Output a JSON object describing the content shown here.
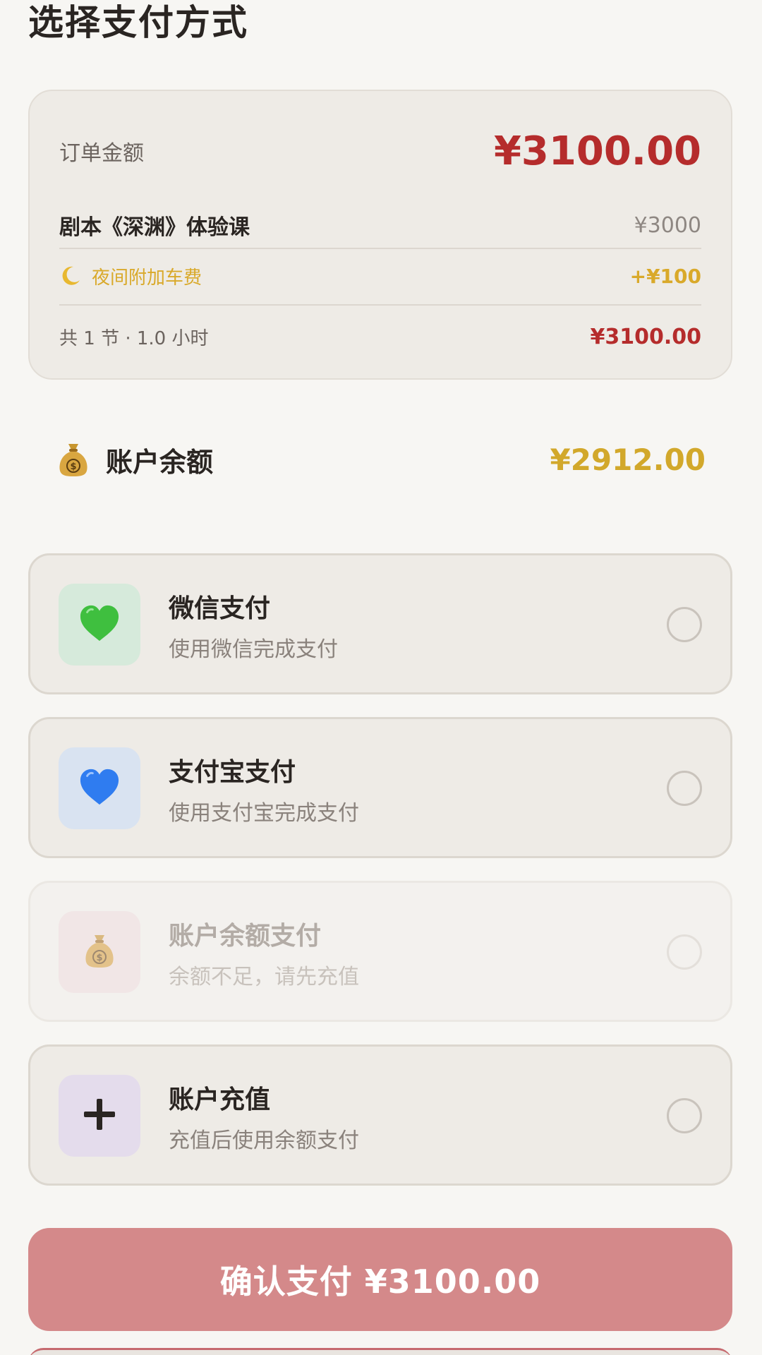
{
  "page": {
    "title": "选择支付方式"
  },
  "order": {
    "amount_label": "订单金额",
    "amount_value": "¥3100.00",
    "course_label": "剧本《深渊》体验课",
    "course_value": "¥3000",
    "surcharge_icon": "moon-icon",
    "surcharge_label": "夜间附加车费",
    "surcharge_value": "+¥100",
    "total_label": "共 1 节 · 1.0 小时",
    "total_value": "¥3100.00"
  },
  "balance": {
    "icon": "money-bag-icon",
    "label": "账户余额",
    "value": "¥2912.00"
  },
  "payment_options": [
    {
      "icon": "green-heart-icon",
      "title": "微信支付",
      "subtitle": "使用微信完成支付",
      "selected": false,
      "enabled": true,
      "icon_bg": "#d6eadb",
      "icon_color": "#3fbf3f"
    },
    {
      "icon": "blue-heart-icon",
      "title": "支付宝支付",
      "subtitle": "使用支付宝完成支付",
      "selected": false,
      "enabled": true,
      "icon_bg": "#d9e3f1",
      "icon_color": "#2f7cf0"
    },
    {
      "icon": "money-bag-icon",
      "title": "账户余额支付",
      "subtitle": "余额不足，请先充值",
      "selected": false,
      "enabled": false,
      "icon_bg": "#f1e6e6"
    },
    {
      "icon": "plus-icon",
      "title": "账户充值",
      "subtitle": "充值后使用余额支付",
      "selected": false,
      "enabled": true,
      "icon_bg": "#e4dcec"
    }
  ],
  "confirm": {
    "label": "确认支付 ¥3100.00"
  },
  "colors": {
    "background": "#f7f6f3",
    "accent_red": "#b52c2c",
    "gold": "#d2a82b",
    "confirm_button": "#d4898a"
  }
}
